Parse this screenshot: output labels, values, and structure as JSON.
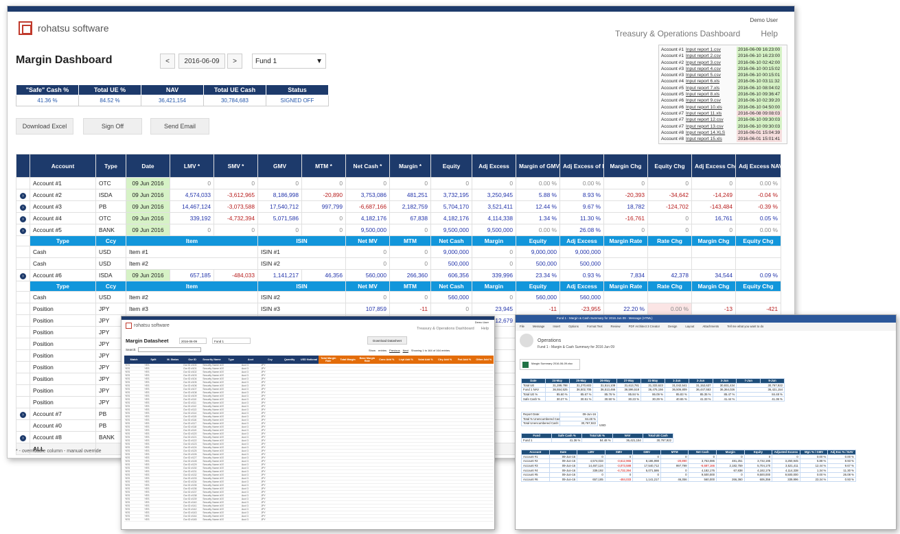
{
  "user": "Demo User",
  "brand": "rohatsu software",
  "nav": {
    "dashboard": "Treasury & Operations Dashboard",
    "help": "Help"
  },
  "title": "Margin Dashboard",
  "date_nav": {
    "prev": "<",
    "date": "2016-06-09",
    "next": ">"
  },
  "fund": "Fund 1",
  "kpis": {
    "headers": [
      "\"Safe\" Cash %",
      "Total UE %",
      "NAV",
      "Total UE Cash",
      "Status"
    ],
    "values": [
      "41.36 %",
      "84.52 %",
      "36,421,154",
      "30,784,683",
      "SIGNED OFF"
    ]
  },
  "actions": [
    "Download Excel",
    "Sign Off",
    "Send Email"
  ],
  "files": [
    [
      "Account #1",
      "Input report 1.csv",
      "2016-06-09 16:23:00",
      "ok"
    ],
    [
      "Account #1",
      "Input report 2.csv",
      "2016-06-10 16:23:00",
      "ok"
    ],
    [
      "Account #2",
      "Input report 3.csv",
      "2016-06-10 02:42:00",
      "ok"
    ],
    [
      "Account #3",
      "Input report 4.csv",
      "2016-06-10 00:15:02",
      "ok"
    ],
    [
      "Account #3",
      "Input report 5.csv",
      "2016-06-10 00:15:01",
      "ok"
    ],
    [
      "Account #4",
      "Input report 6.xls",
      "2016-06-10 03:11:32",
      "ok"
    ],
    [
      "Account #5",
      "Input report 7.xls",
      "2016-06-10 08:04:02",
      "ok"
    ],
    [
      "Account #5",
      "Input report 8.xls",
      "2016-06-10 09:36:47",
      "ok"
    ],
    [
      "Account #6",
      "Input report 9.csv",
      "2016-06-10 02:39:20",
      "ok"
    ],
    [
      "Account #6",
      "Input report 10.xls",
      "2016-06-10 04:50:00",
      "ok"
    ],
    [
      "Account #7",
      "Input report 11.xls",
      "2016-06-08 09:08:03",
      "bad"
    ],
    [
      "Account #7",
      "Input report 12.csv",
      "2016-06-10 09:30:03",
      "ok"
    ],
    [
      "Account #7",
      "Input report 13.csv",
      "2016-06-10 09:30:03",
      "ok"
    ],
    [
      "Account #8",
      "Input report 14.XLS",
      "2016-06-01 15:04:39",
      "bad"
    ],
    [
      "Account #8",
      "Input report 15.xls",
      "2016-06-01 15:01:41",
      "bad"
    ]
  ],
  "grid_headers": [
    "Account",
    "Type",
    "Date",
    "LMV *",
    "SMV *",
    "GMV",
    "MTM *",
    "Net Cash *",
    "Margin *",
    "Equity",
    "Adj Excess",
    "Margin of GMV %",
    "Adj Excess of NAV %",
    "Margin Chg",
    "Equity Chg",
    "Adj Excess Chg",
    "Adj Excess NAV% Chg"
  ],
  "sub_headers": [
    "Type",
    "Ccy",
    "Item",
    "ISIN",
    "Net MV",
    "MTM",
    "Net Cash",
    "Margin",
    "Equity",
    "Adj Excess",
    "Margin Rate",
    "Rate Chg",
    "Margin Chg",
    "Equity Chg",
    "AdjEx Chg",
    "Ticker"
  ],
  "rows": [
    {
      "kind": "acct",
      "exp": false,
      "c": [
        "Account #1",
        "OTC",
        "09 Jun 2016",
        "0",
        "0",
        "0",
        "0",
        "0",
        "0",
        "0",
        "0",
        "0.00 %",
        "0.00 %",
        "0",
        "0",
        "0",
        "0.00 %"
      ]
    },
    {
      "kind": "acct",
      "exp": true,
      "c": [
        "Account #2",
        "ISDA",
        "09 Jun 2016",
        "4,574,033",
        "-3,612,965",
        "8,186,998",
        "-20,890",
        "3,753,086",
        "481,251",
        "3,732,195",
        "3,250,945",
        "5.88 %",
        "8.93 %",
        "-20,393",
        "-34,642",
        "-14,249",
        "-0.04 %"
      ]
    },
    {
      "kind": "acct",
      "exp": true,
      "c": [
        "Account #3",
        "PB",
        "09 Jun 2016",
        "14,467,124",
        "-3,073,588",
        "17,540,712",
        "997,799",
        "-6,687,166",
        "2,182,759",
        "5,704,170",
        "3,521,411",
        "12.44 %",
        "9.67 %",
        "18,782",
        "-124,702",
        "-143,484",
        "-0.39 %"
      ]
    },
    {
      "kind": "acct",
      "exp": true,
      "c": [
        "Account #4",
        "OTC",
        "09 Jun 2016",
        "339,192",
        "-4,732,394",
        "5,071,586",
        "0",
        "4,182,176",
        "67,838",
        "4,182,176",
        "4,114,338",
        "1.34 %",
        "11.30 %",
        "-16,761",
        "0",
        "16,761",
        "0.05 %"
      ]
    },
    {
      "kind": "acct",
      "exp": true,
      "c": [
        "Account #5",
        "BANK",
        "09 Jun 2016",
        "0",
        "0",
        "0",
        "0",
        "9,500,000",
        "0",
        "9,500,000",
        "9,500,000",
        "0.00 %",
        "26.08 %",
        "0",
        "0",
        "0",
        "0.00 %"
      ]
    },
    {
      "kind": "sub"
    },
    {
      "kind": "pos",
      "c": [
        "Cash",
        "USD",
        "Item #1",
        "ISIN #1",
        "0",
        "0",
        "9,000,000",
        "0",
        "9,000,000",
        "9,000,000",
        "",
        "",
        "",
        "",
        "",
        "1"
      ]
    },
    {
      "kind": "pos",
      "c": [
        "Cash",
        "USD",
        "Item #2",
        "ISIN #2",
        "0",
        "0",
        "500,000",
        "0",
        "500,000",
        "500,000",
        "",
        "",
        "",
        "",
        "",
        "2"
      ]
    },
    {
      "kind": "acct",
      "exp": true,
      "c": [
        "Account #6",
        "ISDA",
        "09 Jun 2016",
        "657,185",
        "-484,033",
        "1,141,217",
        "46,356",
        "560,000",
        "266,360",
        "606,356",
        "339,996",
        "23.34 %",
        "0.93 %",
        "7,834",
        "42,378",
        "34,544",
        "0.09 %"
      ]
    },
    {
      "kind": "sub"
    },
    {
      "kind": "pos",
      "c": [
        "Cash",
        "USD",
        "Item #2",
        "ISIN #2",
        "0",
        "0",
        "560,000",
        "0",
        "560,000",
        "560,000",
        "",
        "",
        "",
        "",
        "",
        "2"
      ]
    },
    {
      "kind": "pos",
      "c": [
        "Position",
        "JPY",
        "Item #3",
        "ISIN #3",
        "107,859",
        "-11",
        "0",
        "23,945",
        "-11",
        "-23,955",
        "22.20 %",
        "0.00 %",
        "-13",
        "-421",
        "-408",
        "3"
      ]
    },
    {
      "kind": "pos",
      "c": [
        "Position",
        "JPY",
        "Item #4",
        "ISIN #4",
        "85,670",
        "9,969",
        "0",
        "12,679",
        "9,969",
        "-2,710",
        "14.80 %",
        "0.00 %",
        "-73",
        "-747",
        "-674",
        "4"
      ]
    },
    {
      "kind": "pos",
      "c": [
        "Position",
        "JPY",
        "Item #5",
        "",
        "",
        "",
        "",
        "",
        "",
        "",
        "",
        "",
        "",
        "",
        "",
        ""
      ]
    },
    {
      "kind": "pos",
      "c": [
        "Position",
        "JPY",
        "Item #6",
        "",
        "",
        "",
        "",
        "",
        "",
        "",
        "",
        "",
        "",
        "",
        "",
        ""
      ]
    },
    {
      "kind": "pos",
      "c": [
        "Position",
        "JPY",
        "Item #7",
        "",
        "",
        "",
        "",
        "",
        "",
        "",
        "",
        "",
        "",
        "",
        "",
        ""
      ]
    },
    {
      "kind": "pos",
      "c": [
        "Position",
        "JPY",
        "Item #8",
        "",
        "",
        "",
        "",
        "",
        "",
        "",
        "",
        "",
        "",
        "",
        "",
        ""
      ]
    },
    {
      "kind": "pos",
      "c": [
        "Position",
        "JPY",
        "Item #11",
        "",
        "",
        "",
        "",
        "",
        "",
        "",
        "",
        "",
        "",
        "",
        "",
        ""
      ]
    },
    {
      "kind": "pos",
      "c": [
        "Position",
        "JPY",
        "Item #12",
        "",
        "",
        "",
        "",
        "",
        "",
        "",
        "",
        "",
        "",
        "",
        "",
        ""
      ]
    },
    {
      "kind": "pos",
      "c": [
        "Position",
        "JPY",
        "Item #13",
        "",
        "",
        "",
        "",
        "",
        "",
        "",
        "",
        "",
        "",
        "",
        "",
        ""
      ]
    },
    {
      "kind": "acct",
      "exp": true,
      "c": [
        "Account #7",
        "PB",
        "",
        "",
        "",
        "",
        "",
        "",
        "",
        "",
        "",
        "",
        "",
        "",
        "",
        "",
        ""
      ]
    },
    {
      "kind": "acct",
      "exp": false,
      "c": [
        "Account #0",
        "PB",
        "",
        "",
        "",
        "",
        "",
        "",
        "",
        "",
        "",
        "",
        "",
        "",
        "",
        "",
        ""
      ]
    },
    {
      "kind": "acct",
      "exp": true,
      "c": [
        "Account #8",
        "BANK",
        "",
        "",
        "",
        "",
        "",
        "",
        "",
        "",
        "",
        "",
        "",
        "",
        "",
        "",
        ""
      ]
    },
    {
      "kind": "all",
      "c": [
        "ALL",
        "",
        "",
        "",
        "",
        "",
        "",
        "",
        "",
        "",
        "",
        "",
        "",
        "",
        "",
        "",
        ""
      ]
    }
  ],
  "footer": "* - overridable column      - manual override",
  "datasheet": {
    "title": "Margin Datasheet",
    "date": "2016-06-09",
    "fund": "Fund 1",
    "download": "Download Datasheet",
    "search": "Search:",
    "show": "Show",
    "entries": "entries",
    "paging": "Showing 1 to 164 of 164 entries",
    "prev": "Previous",
    "next": "Next"
  },
  "mail": {
    "subject": "Fund 1 - Margin & Cash Summary for 2016 Jun 09 - Message (HTML)",
    "sender": "Operations",
    "line": "Fund 1 - Margin & Cash Summary for 2016 Jun 09",
    "attachment": "Margin Summary 2016-06-09.xlsx",
    "tabs": [
      "File",
      "Message",
      "Insert",
      "Options",
      "Format Text",
      "Review",
      "PDF Architect 3 Creator",
      "Design",
      "Layout",
      "Attachments"
    ],
    "tellme": "Tell me what you want to do",
    "dates": [
      "Date",
      "24-May",
      "25-May",
      "26-May",
      "27-May",
      "31-May",
      "1-Jun",
      "2-Jun",
      "3-Jun",
      "7-Jun",
      "9-Jun"
    ],
    "summary": [
      [
        "Total UE",
        "31,289,798",
        "31,270,603",
        "31,514,108",
        "31,613,781",
        "31,333,623",
        "31,042,541",
        "31,152,637",
        "30,931,434",
        "30,767,922"
      ],
      [
        "Fund 1 NAV",
        "36,554,525",
        "36,502,705",
        "36,513,466",
        "36,596,518",
        "36,475,156",
        "36,506,809",
        "36,447,553",
        "36,364,026",
        "36,421,154"
      ],
      [
        "Total UE %",
        "85.60 %",
        "85.67 %",
        "85.76 %",
        "85.84 %",
        "86.09 %",
        "85.83 %",
        "85.35 %",
        "85.47 %",
        "84.48 %"
      ],
      [
        "Safe Cash %",
        "30.27 %",
        "30.51 %",
        "30.50 %",
        "30.23 %",
        "30.29 %",
        "40.65 %",
        "41.33 %",
        "41.44 %",
        "41.36 %"
      ]
    ],
    "report_date": "09-Jun-16",
    "unenc_pct": "84.48 %",
    "unenc_cash": "30,767,922",
    "ccy": "USD",
    "fund_row": [
      "Fund 1",
      "41.36 %",
      "84.48 %",
      "36,421,154",
      "30,767,922"
    ]
  }
}
